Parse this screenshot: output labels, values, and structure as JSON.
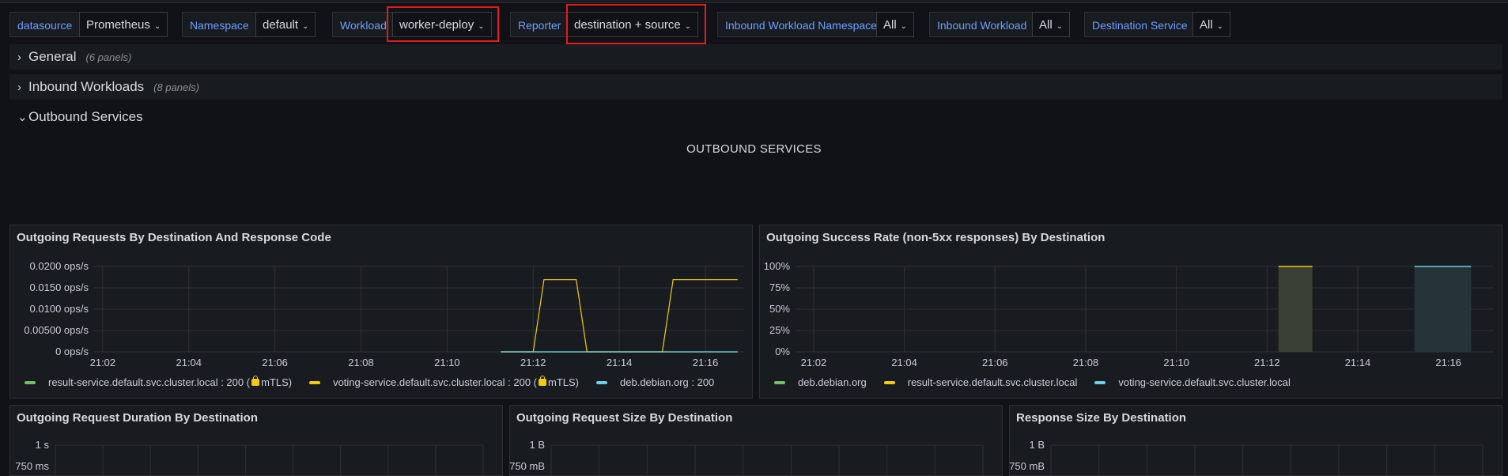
{
  "variables": [
    {
      "label": "datasource",
      "value": "Prometheus"
    },
    {
      "label": "Namespace",
      "value": "default"
    },
    {
      "label": "Workload",
      "value": "worker-deploy"
    },
    {
      "label": "Reporter",
      "value": "destination + source"
    },
    {
      "label": "Inbound Workload Namespace",
      "value": "All"
    },
    {
      "label": "Inbound Workload",
      "value": "All"
    },
    {
      "label": "Destination Service",
      "value": "All"
    }
  ],
  "rows": [
    {
      "title": "General",
      "count": "(6 panels)",
      "collapsed": true
    },
    {
      "title": "Inbound Workloads",
      "count": "(8 panels)",
      "collapsed": true
    },
    {
      "title": "Outbound Services",
      "count": "",
      "collapsed": false
    }
  ],
  "text_panel": {
    "content": "OUTBOUND SERVICES"
  },
  "colors": {
    "green": "#73bf69",
    "yellow": "#f2cc0c",
    "blue": "#8ab8ff",
    "cyan": "#6ed0e0",
    "highlight": "#e31b1b"
  },
  "panels": {
    "requests": {
      "title": "Outgoing Requests By Destination And Response Code",
      "legend": [
        {
          "prefix": "result-service.default.svc.cluster.local : 200 (",
          "suffix": "mTLS)",
          "lock": true,
          "color": "#73bf69"
        },
        {
          "prefix": "voting-service.default.svc.cluster.local : 200 (",
          "suffix": "mTLS)",
          "lock": true,
          "color": "#f2cc0c"
        },
        {
          "prefix": "deb.debian.org : 200",
          "suffix": "",
          "lock": false,
          "color": "#6ed0e0"
        }
      ]
    },
    "success": {
      "title": "Outgoing Success Rate (non-5xx responses) By Destination",
      "legend": [
        {
          "prefix": "deb.debian.org",
          "suffix": "",
          "lock": false,
          "color": "#73bf69"
        },
        {
          "prefix": "result-service.default.svc.cluster.local",
          "suffix": "",
          "lock": false,
          "color": "#f2cc0c"
        },
        {
          "prefix": "voting-service.default.svc.cluster.local",
          "suffix": "",
          "lock": false,
          "color": "#6ed0e0"
        }
      ]
    },
    "duration": {
      "title": "Outgoing Request Duration By Destination",
      "y_ticks": [
        "1 s",
        "750 ms"
      ]
    },
    "req_size": {
      "title": "Outgoing Request Size By Destination",
      "y_ticks": [
        "1 B",
        "750 mB"
      ]
    },
    "resp_size": {
      "title": "Response Size By Destination",
      "y_ticks": [
        "1 B",
        "750 mB"
      ]
    }
  },
  "chart_data": [
    {
      "type": "line",
      "title": "Outgoing Requests By Destination And Response Code",
      "x_ticks": [
        "21:02",
        "21:04",
        "21:06",
        "21:08",
        "21:10",
        "21:12",
        "21:14",
        "21:16"
      ],
      "y_ticks": [
        "0 ops/s",
        "0.00500 ops/s",
        "0.0100 ops/s",
        "0.0150 ops/s",
        "0.0200 ops/s"
      ],
      "ylim": [
        0,
        0.02
      ],
      "xlim": [
        "21:01.8",
        "21:16.9"
      ],
      "series": [
        {
          "name": "result-service.default.svc.cluster.local : 200 (mTLS)",
          "color": "#73bf69",
          "points": [
            [
              "21:11.25",
              0
            ],
            [
              "21:16.75",
              0
            ]
          ]
        },
        {
          "name": "voting-service.default.svc.cluster.local : 200 (mTLS)",
          "color": "#f2cc0c",
          "points": [
            [
              "21:11.25",
              0
            ],
            [
              "21:12.0",
              0
            ],
            [
              "21:12.25",
              0.0169
            ],
            [
              "21:13.0",
              0.0169
            ],
            [
              "21:13.25",
              0
            ],
            [
              "21:15.0",
              0
            ],
            [
              "21:15.25",
              0.0169
            ],
            [
              "21:16.75",
              0.0169
            ]
          ]
        },
        {
          "name": "deb.debian.org : 200",
          "color": "#6ed0e0",
          "points": [
            [
              "21:11.25",
              0
            ],
            [
              "21:16.75",
              0
            ]
          ]
        }
      ]
    },
    {
      "type": "bar",
      "title": "Outgoing Success Rate (non-5xx responses) By Destination",
      "x_ticks": [
        "21:02",
        "21:04",
        "21:06",
        "21:08",
        "21:10",
        "21:12",
        "21:14",
        "21:16"
      ],
      "y_ticks": [
        "0%",
        "25%",
        "50%",
        "75%",
        "100%"
      ],
      "ylim": [
        0,
        100
      ],
      "xlim": [
        "21:01.6",
        "21:17.0"
      ],
      "series": [
        {
          "name": "result-service.default.svc.cluster.local",
          "color": "#f2cc0c",
          "fill": "#3a3f35",
          "bars": [
            {
              "x_start": "21:12.25",
              "x_end": "21:13.0",
              "value": 100
            }
          ]
        },
        {
          "name": "voting-service.default.svc.cluster.local",
          "color": "#6ed0e0",
          "fill": "#26343a",
          "bars": [
            {
              "x_start": "21:15.25",
              "x_end": "21:16.5",
              "value": 100
            }
          ]
        }
      ]
    }
  ]
}
